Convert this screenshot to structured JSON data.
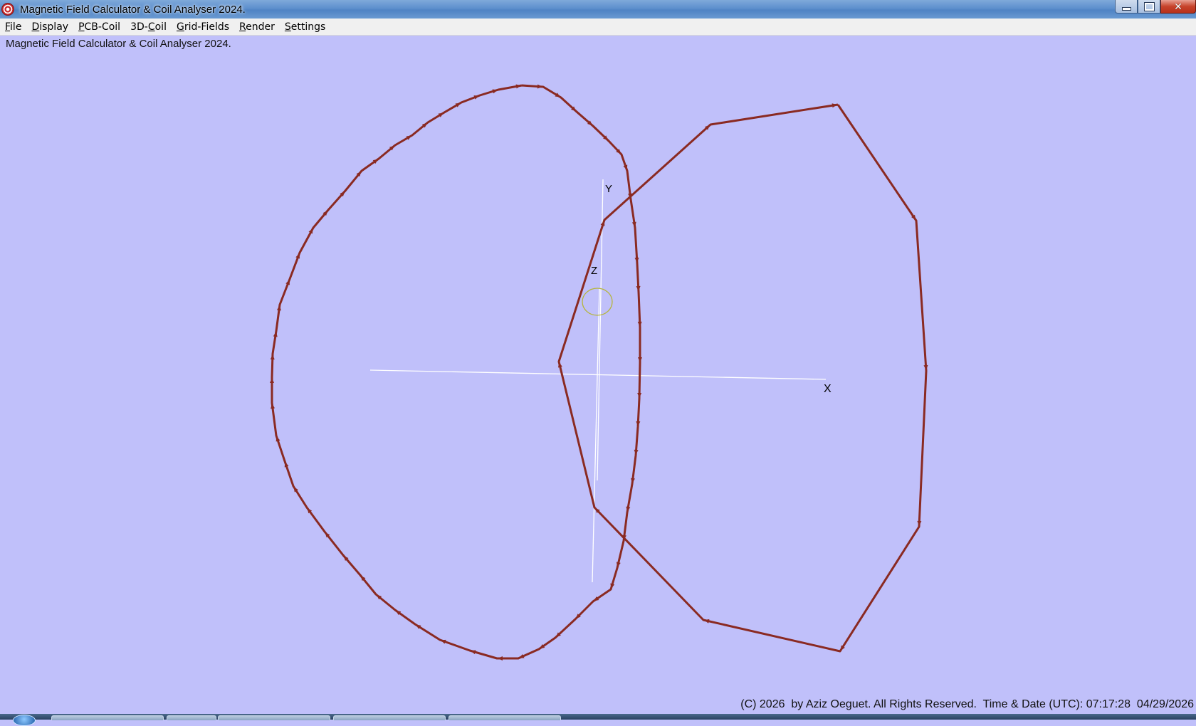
{
  "window": {
    "title": "Magnetic Field Calculator & Coil Analyser 2024.",
    "minimize_icon": "minimize-icon",
    "maximize_icon": "maximize-icon",
    "close_icon": "close-icon"
  },
  "menu": {
    "items": [
      "File",
      "Display",
      "PCB-Coil",
      "3D-Coil",
      "Grid-Fields",
      "Render",
      "Settings"
    ],
    "mnemonics": [
      "F",
      "D",
      "P",
      "C",
      "G",
      "R",
      "S"
    ]
  },
  "caption": "Magnetic Field Calculator & Coil Analyser 2024.",
  "axes": {
    "x_label": "X",
    "y_label": "Y",
    "z_label": "Z"
  },
  "colors": {
    "background": "#c0c0fa",
    "coil": "#8a2a22",
    "axis": "#ffffff",
    "origin_marker": "#b5b53a"
  },
  "footer": "(C) 2026  by Aziz Oeguet. All Rights Reserved.  Time & Date (UTC): 07:17:28  04/29/2026",
  "taskbar": {
    "buttons": 5
  }
}
